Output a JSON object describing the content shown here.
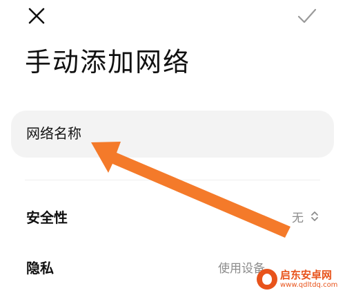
{
  "header": {
    "title": "手动添加网络"
  },
  "form": {
    "ssid_placeholder": "网络名称"
  },
  "rows": {
    "security_label": "安全性",
    "security_value": "无",
    "privacy_label": "隐私",
    "privacy_value": "使用设备"
  },
  "watermark": {
    "name": "启东安卓网",
    "url": "www.qdltdq.com"
  },
  "icons": {
    "close": "close-icon",
    "confirm": "check-icon",
    "security_selector": "up-down-chevron-icon",
    "annotation": "orange-arrow"
  },
  "colors": {
    "annotation_arrow": "#f47a2a",
    "field_background": "#f3f3f3",
    "muted_text": "#8c8c8c",
    "watermark": "#e8531b"
  }
}
